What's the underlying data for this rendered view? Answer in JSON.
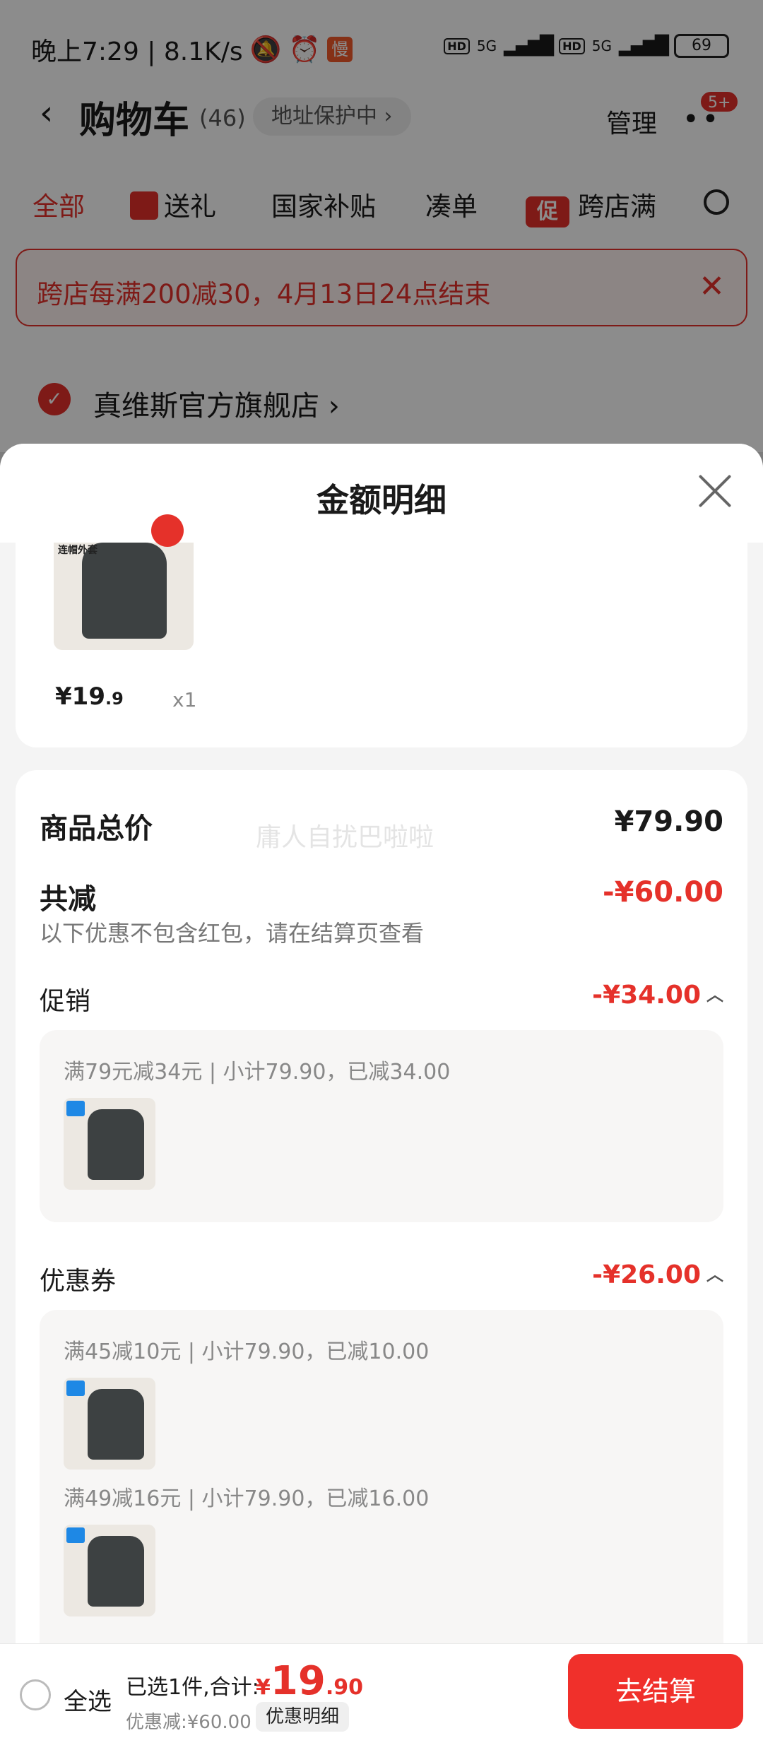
{
  "status_bar": {
    "time": "晚上7:29 | 8.1K/s",
    "slow_badge": "慢",
    "hd1": "HD",
    "net1": "5G",
    "hd2": "HD",
    "net2": "5G",
    "battery": "69"
  },
  "nav": {
    "title": "购物车",
    "count": "(46)",
    "address_protect": "地址保护中",
    "manage": "管理",
    "more_badge": "5+"
  },
  "tabs": [
    "全部",
    "送礼",
    "国家补贴",
    "凑单",
    "跨店满"
  ],
  "promo_icon": "促",
  "banner": {
    "text": "跨店每满200减30，4月13日24点结束",
    "close": "✕"
  },
  "store": {
    "name": "真维斯官方旗舰店"
  },
  "sheet": {
    "title": "金额明细",
    "product": {
      "thumb_label": "连帽外套",
      "price_int": "¥19",
      "price_dec": ".9",
      "qty": "x1"
    },
    "goods_total_label": "商品总价",
    "goods_total_value": "¥79.90",
    "watermark": "庸人自扰巴啦啦",
    "discount_label": "共减",
    "discount_value": "-¥60.00",
    "discount_note": "以下优惠不包含红包，请在结算页查看",
    "promo_label": "促销",
    "promo_value": "-¥34.00",
    "promo_rule": "满79元减34元 | 小计79.90，已减34.00",
    "coupon_label": "优惠券",
    "coupon_value": "-¥26.00",
    "coupon_rule_1": "满45减10元 | 小计79.90，已减10.00",
    "coupon_rule_2": "满49减16元 | 小计79.90，已减16.00"
  },
  "bottom_bar": {
    "select_all": "全选",
    "summary": "已选1件,合计:",
    "total_currency": "¥",
    "total_int": "19",
    "total_dec": ".90",
    "saved": "优惠减:¥60.00",
    "detail_button": "优惠明细",
    "checkout": "去结算"
  },
  "colors": {
    "accent": "#e5312a",
    "checkout": "#f0302b"
  }
}
